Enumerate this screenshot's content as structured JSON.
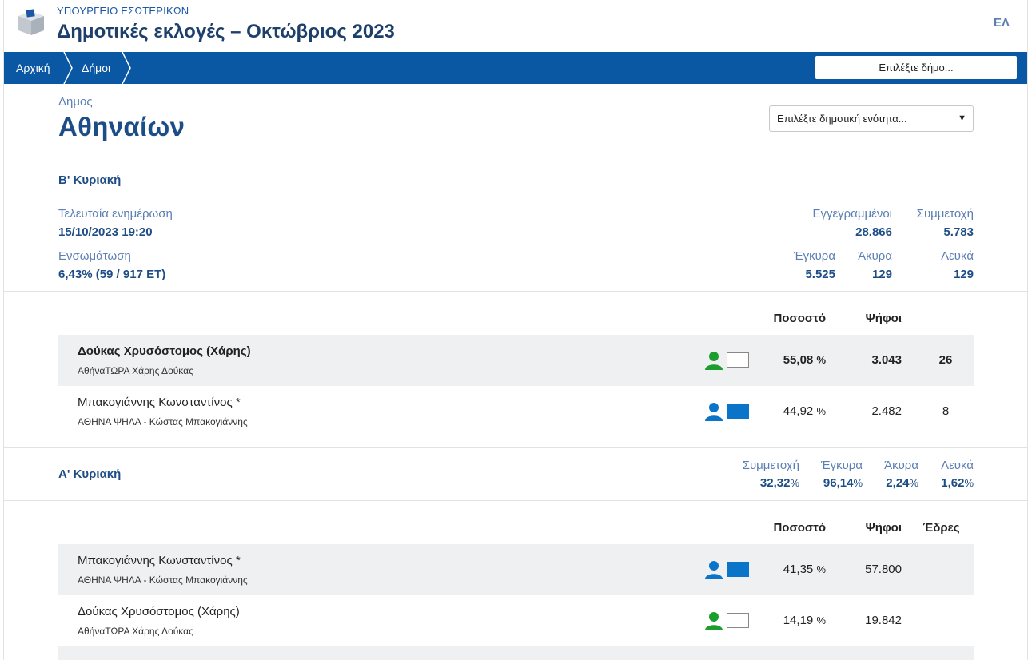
{
  "header": {
    "ministry": "ΥΠΟΥΡΓΕΙΟ ΕΣΩΤΕΡΙΚΩΝ",
    "title": "Δημοτικές εκλογές – Οκτώβριος 2023",
    "language": "ΕΛ"
  },
  "nav": {
    "home": "Αρχική",
    "municipalities": "Δήμοι",
    "select_placeholder": "Επιλέξτε δήμο..."
  },
  "municipality": {
    "label": "Δημος",
    "name": "Αθηναίων",
    "unit_select_placeholder": "Επιλέξτε δημοτική ενότητα..."
  },
  "round_b": {
    "title": "Β' Κυριακή",
    "last_update_label": "Τελευταία ενημέρωση",
    "last_update_value": "15/10/2023 19:20",
    "integration_label": "Ενσωμάτωση",
    "integration_value": "6,43% (59 / 917 ΕΤ)",
    "registered_label": "Εγγεγραμμένοι",
    "registered_value": "28.866",
    "turnout_label": "Συμμετοχή",
    "turnout_value": "5.783",
    "valid_label": "Έγκυρα",
    "valid_value": "5.525",
    "invalid_label": "Άκυρα",
    "invalid_value": "129",
    "blank_label": "Λευκά",
    "blank_value": "129",
    "col_percent": "Ποσοστό",
    "col_votes": "Ψήφοι",
    "candidates": [
      {
        "name": "Δούκας Χρυσόστομος (Χάρης)",
        "party": "ΑθήναΤΩΡΑ Χάρης Δούκας",
        "percent": "55,08",
        "percent_sym": "%",
        "votes": "3.043",
        "seats": "26",
        "icon_color": "#1b9e2d",
        "box": "white"
      },
      {
        "name": "Μπακογιάννης Κωνσταντίνος *",
        "party": "ΑΘΗΝΑ ΨΗΛΑ - Κώστας Μπακογιάννης",
        "percent": "44,92",
        "percent_sym": "%",
        "votes": "2.482",
        "seats": "8",
        "icon_color": "#0a74c9",
        "box": "blue"
      }
    ]
  },
  "round_a": {
    "title": "Α' Κυριακή",
    "turnout_label": "Συμμετοχή",
    "turnout_value": "32,32",
    "valid_label": "Έγκυρα",
    "valid_value": "96,14",
    "invalid_label": "Άκυρα",
    "invalid_value": "2,24",
    "blank_label": "Λευκά",
    "blank_value": "1,62",
    "percent_sym": "%",
    "col_percent": "Ποσοστό",
    "col_votes": "Ψήφοι",
    "col_seats": "Έδρες",
    "candidates": [
      {
        "name": "Μπακογιάννης Κωνσταντίνος *",
        "party": "ΑΘΗΝΑ ΨΗΛΑ - Κώστας Μπακογιάννης",
        "percent": "41,35",
        "percent_sym": "%",
        "votes": "57.800",
        "icon_color": "#0a74c9",
        "box": "blue"
      },
      {
        "name": "Δούκας Χρυσόστομος (Χάρης)",
        "party": "ΑθήναΤΩΡΑ Χάρης Δούκας",
        "percent": "14,19",
        "percent_sym": "%",
        "votes": "19.842",
        "icon_color": "#1b9e2d",
        "box": "white"
      }
    ]
  },
  "icons": [
    "ballot-box-icon",
    "person-icon",
    "chevron-down-icon"
  ]
}
